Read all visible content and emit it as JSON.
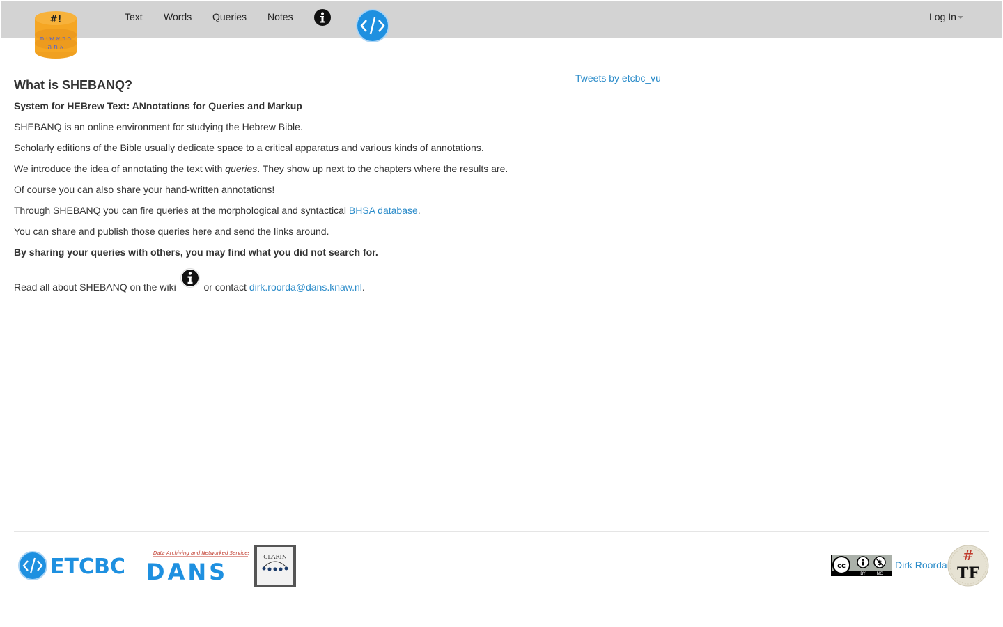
{
  "nav": {
    "links": [
      "Text",
      "Words",
      "Queries",
      "Notes"
    ],
    "login_label": "Log In",
    "brand_mark": "#!"
  },
  "main": {
    "heading": "What is SHEBANQ?",
    "subtitle": "System for HEBrew Text: ANnotations for Queries and Markup",
    "p1": "SHEBANQ is an online environment for studying the Hebrew Bible.",
    "p2": "Scholarly editions of the Bible usually dedicate space to a critical apparatus and various kinds of annotations.",
    "p3_before": "We introduce the idea of annotating the text with ",
    "p3_em": "queries",
    "p3_after": ". They show up next to the chapters where the results are.",
    "p4": "Of course you can also share your hand-written annotations!",
    "p5_before": "Through SHEBANQ you can fire queries at the morphological and syntactical ",
    "p5_link": "BHSA database",
    "p5_after": ".",
    "p6": "You can share and publish those queries here and send the links around.",
    "p7": "By sharing your queries with others, you may find what you did not search for.",
    "p8_before": "Read all about SHEBANQ on the wiki ",
    "p8_middle": " or contact ",
    "p8_email": "dirk.roorda@dans.knaw.nl",
    "p8_after": "."
  },
  "sidebar": {
    "tweets_link": "Tweets by etcbc_vu"
  },
  "footer": {
    "etcbc_text": "ETCBC",
    "dans_tagline": "Data Archiving and Networked Services",
    "dans_text": "DANS",
    "clarin_text": "CLARIN",
    "cc_labels": [
      "BY",
      "NC"
    ],
    "author_link": "Dirk Roorda",
    "tf_text": "TF",
    "tf_hash": "#"
  },
  "colors": {
    "navbar_bg": "#d3d3d3",
    "link": "#2a8bc9",
    "etcbc_blue": "#1e90e0",
    "brand_orange": "#f5a623"
  },
  "icons": [
    "info-icon",
    "etcbc-logo-icon",
    "shebanq-logo-icon",
    "caret-down-icon"
  ]
}
